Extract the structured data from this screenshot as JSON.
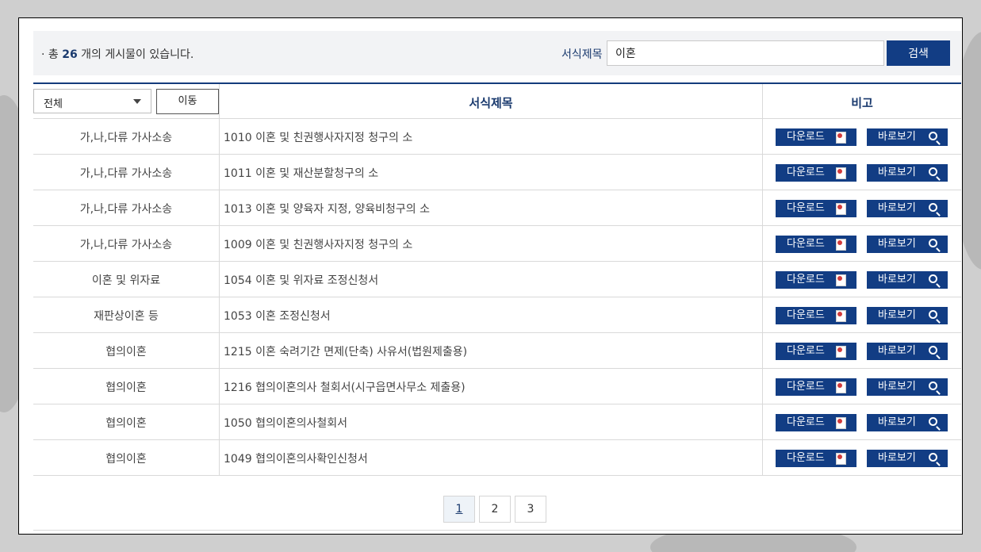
{
  "summary": {
    "prefix": "· 총 ",
    "count": "26",
    "suffix": " 개의 게시물이 있습니다."
  },
  "search": {
    "label": "서식제목",
    "value": "이혼",
    "button": "검색"
  },
  "filter": {
    "selected": "전체",
    "move_button": "이동"
  },
  "table": {
    "headers": {
      "title": "서식제목",
      "note": "비고"
    },
    "rows": [
      {
        "category": "가,나,다류 가사소송",
        "title": "1010 이혼 및 친권행사자지정 청구의 소"
      },
      {
        "category": "가,나,다류 가사소송",
        "title": "1011 이혼 및 재산분할청구의 소"
      },
      {
        "category": "가,나,다류 가사소송",
        "title": "1013 이혼 및 양육자 지정, 양육비청구의 소"
      },
      {
        "category": "가,나,다류 가사소송",
        "title": "1009 이혼 및 친권행사자지정 청구의 소"
      },
      {
        "category": "이혼 및 위자료",
        "title": "1054 이혼 및 위자료 조정신청서"
      },
      {
        "category": "재판상이혼 등",
        "title": "1053 이혼 조정신청서"
      },
      {
        "category": "협의이혼",
        "title": "1215 이혼 숙려기간 면제(단축) 사유서(법원제출용)"
      },
      {
        "category": "협의이혼",
        "title": "1216 협의이혼의사 철회서(시구읍면사무소 제출용)"
      },
      {
        "category": "협의이혼",
        "title": "1050 협의이혼의사철회서"
      },
      {
        "category": "협의이혼",
        "title": "1049 협의이혼의사확인신청서"
      }
    ],
    "download_label": "다운로드",
    "view_label": "바로보기"
  },
  "pagination": [
    "1",
    "2",
    "3"
  ],
  "colors": {
    "accent": "#123d84",
    "header_text": "#1a3a6e"
  },
  "icons": {
    "download": "document-icon",
    "view": "search-icon",
    "select": "caret-down-icon"
  }
}
